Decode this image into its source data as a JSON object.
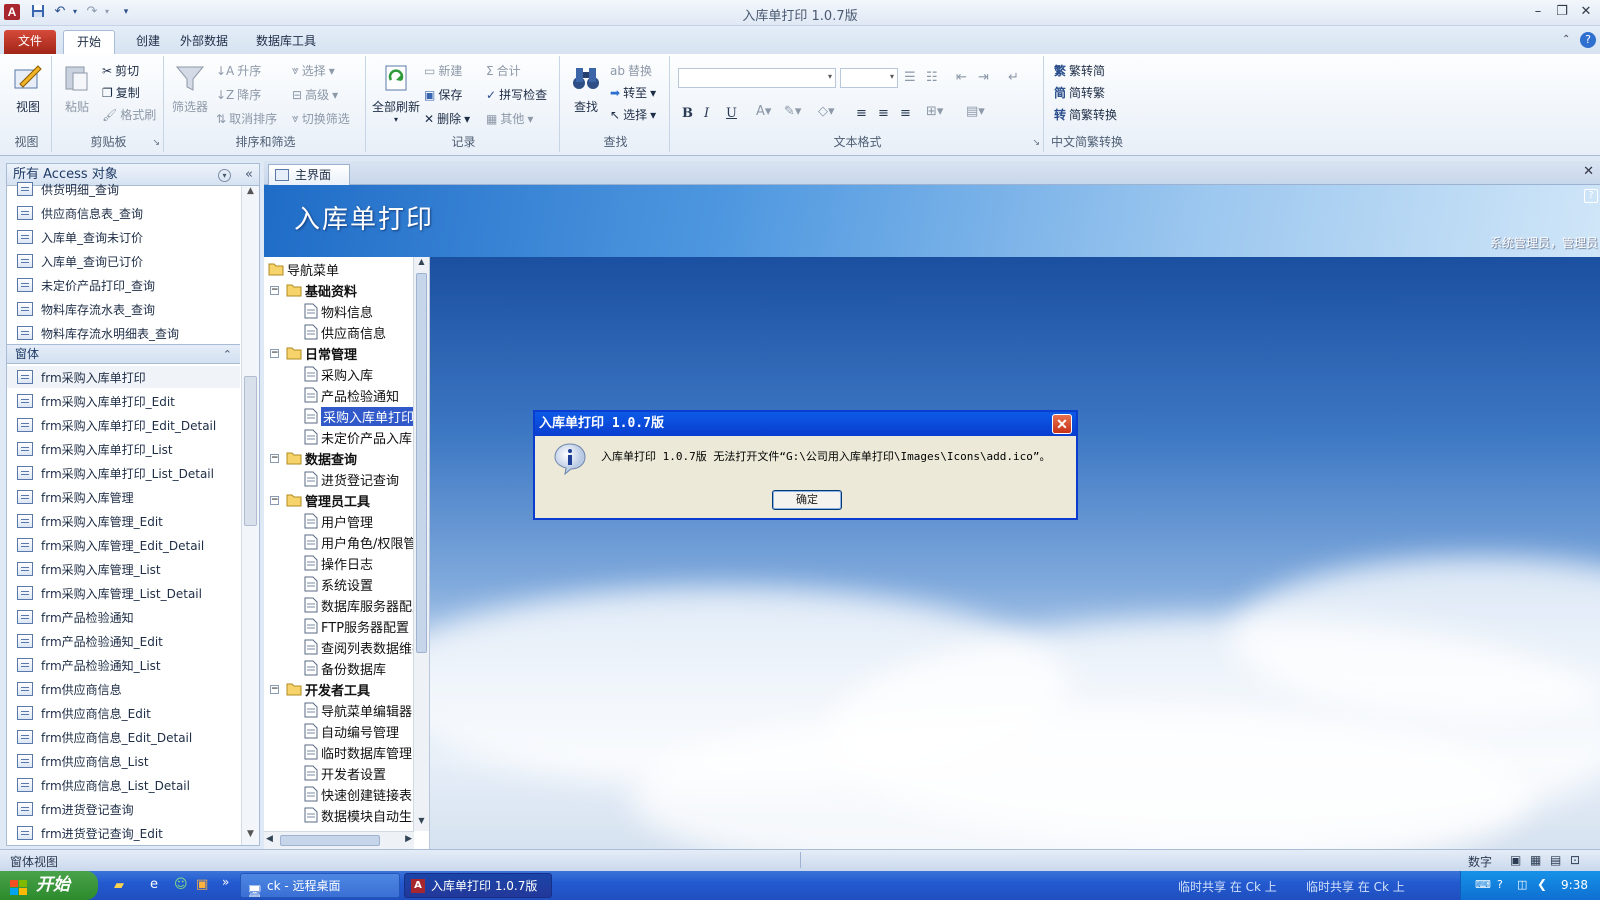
{
  "window": {
    "title": "入库单打印 1.0.7版"
  },
  "ribbon": {
    "tabs": [
      "文件",
      "开始",
      "创建",
      "外部数据",
      "数据库工具"
    ],
    "groups": {
      "view": {
        "label": "视图",
        "button": "视图"
      },
      "clipboard": {
        "label": "剪贴板",
        "paste": "粘贴",
        "cut": "剪切",
        "copy": "复制",
        "format_painter": "格式刷"
      },
      "sort": {
        "label": "排序和筛选",
        "filter": "筛选器",
        "asc": "升序",
        "desc": "降序",
        "clear_sort": "取消排序",
        "selection": "选择",
        "advanced": "高级",
        "toggle_filter": "切换筛选"
      },
      "records": {
        "label": "记录",
        "refresh_all": "全部刷新",
        "new": "新建",
        "save": "保存",
        "delete": "删除",
        "totals": "合计",
        "spelling": "拼写检查",
        "more": "其他"
      },
      "find": {
        "label": "查找",
        "find": "查找",
        "replace": "替换",
        "goto": "转至",
        "select": "选择"
      },
      "text": {
        "label": "文本格式",
        "bold": "B",
        "italic": "I",
        "underline": "U"
      },
      "chinese": {
        "label": "中文简繁转换",
        "to_simp": "繁转简",
        "to_trad": "简转繁",
        "convert": "简繁转换"
      }
    }
  },
  "nav": {
    "header": "所有 Access 对象",
    "queries": [
      "供货明细_查询",
      "供应商信息表_查询",
      "入库单_查询未订价",
      "入库单_查询已订价",
      "未定价产品打印_查询",
      "物料库存流水表_查询",
      "物料库存流水明细表_查询"
    ],
    "section": "窗体",
    "forms": [
      "frm采购入库单打印",
      "frm采购入库单打印_Edit",
      "frm采购入库单打印_Edit_Detail",
      "frm采购入库单打印_List",
      "frm采购入库单打印_List_Detail",
      "frm采购入库管理",
      "frm采购入库管理_Edit",
      "frm采购入库管理_Edit_Detail",
      "frm采购入库管理_List",
      "frm采购入库管理_List_Detail",
      "frm产品检验通知",
      "frm产品检验通知_Edit",
      "frm产品检验通知_List",
      "frm供应商信息",
      "frm供应商信息_Edit",
      "frm供应商信息_Edit_Detail",
      "frm供应商信息_List",
      "frm供应商信息_List_Detail",
      "frm进货登记查询",
      "frm进货登记查询_Edit"
    ]
  },
  "doc": {
    "tab": "主界面",
    "banner_title": "入库单打印",
    "user": "系统管理员，管理员"
  },
  "tree": [
    {
      "label": "导航菜单",
      "level": 0,
      "kind": "root"
    },
    {
      "label": "基础资料",
      "level": 1,
      "kind": "group"
    },
    {
      "label": "物料信息",
      "level": 2,
      "kind": "item"
    },
    {
      "label": "供应商信息",
      "level": 2,
      "kind": "item"
    },
    {
      "label": "日常管理",
      "level": 1,
      "kind": "group"
    },
    {
      "label": "采购入库",
      "level": 2,
      "kind": "item"
    },
    {
      "label": "产品检验通知",
      "level": 2,
      "kind": "item"
    },
    {
      "label": "采购入库单打印",
      "level": 2,
      "kind": "item",
      "selected": true
    },
    {
      "label": "未定价产品入库",
      "level": 2,
      "kind": "item"
    },
    {
      "label": "数据查询",
      "level": 1,
      "kind": "group"
    },
    {
      "label": "进货登记查询",
      "level": 2,
      "kind": "item"
    },
    {
      "label": "管理员工具",
      "level": 1,
      "kind": "group"
    },
    {
      "label": "用户管理",
      "level": 2,
      "kind": "item"
    },
    {
      "label": "用户角色/权限管理",
      "level": 2,
      "kind": "item"
    },
    {
      "label": "操作日志",
      "level": 2,
      "kind": "item"
    },
    {
      "label": "系统设置",
      "level": 2,
      "kind": "item"
    },
    {
      "label": "数据库服务器配置",
      "level": 2,
      "kind": "item"
    },
    {
      "label": "FTP服务器配置",
      "level": 2,
      "kind": "item"
    },
    {
      "label": "查阅列表数据维护",
      "level": 2,
      "kind": "item"
    },
    {
      "label": "备份数据库",
      "level": 2,
      "kind": "item"
    },
    {
      "label": "开发者工具",
      "level": 1,
      "kind": "group"
    },
    {
      "label": "导航菜单编辑器",
      "level": 2,
      "kind": "item"
    },
    {
      "label": "自动编号管理",
      "level": 2,
      "kind": "item"
    },
    {
      "label": "临时数据库管理",
      "level": 2,
      "kind": "item"
    },
    {
      "label": "开发者设置",
      "level": 2,
      "kind": "item"
    },
    {
      "label": "快速创建链接表",
      "level": 2,
      "kind": "item"
    },
    {
      "label": "数据模块自动生成",
      "level": 2,
      "kind": "item"
    }
  ],
  "dialog": {
    "title": "入库单打印 1.0.7版",
    "message": "入库单打印 1.0.7版 无法打开文件“G:\\公司用入库单打印\\Images\\Icons\\add.ico”。",
    "ok": "确定"
  },
  "status": {
    "left": "窗体视图",
    "num": "数字"
  },
  "taskbar": {
    "start": "开始",
    "task1": "ck - 远程桌面",
    "task2": "入库单打印 1.0.7版",
    "note1": "临时共享 在 Ck 上",
    "note2": "临时共享 在 Ck 上",
    "time": "9:38"
  },
  "colors": {
    "file_tab": "#c0392b",
    "dialog_title": "#0a3dcf",
    "selection": "#3159c9"
  }
}
